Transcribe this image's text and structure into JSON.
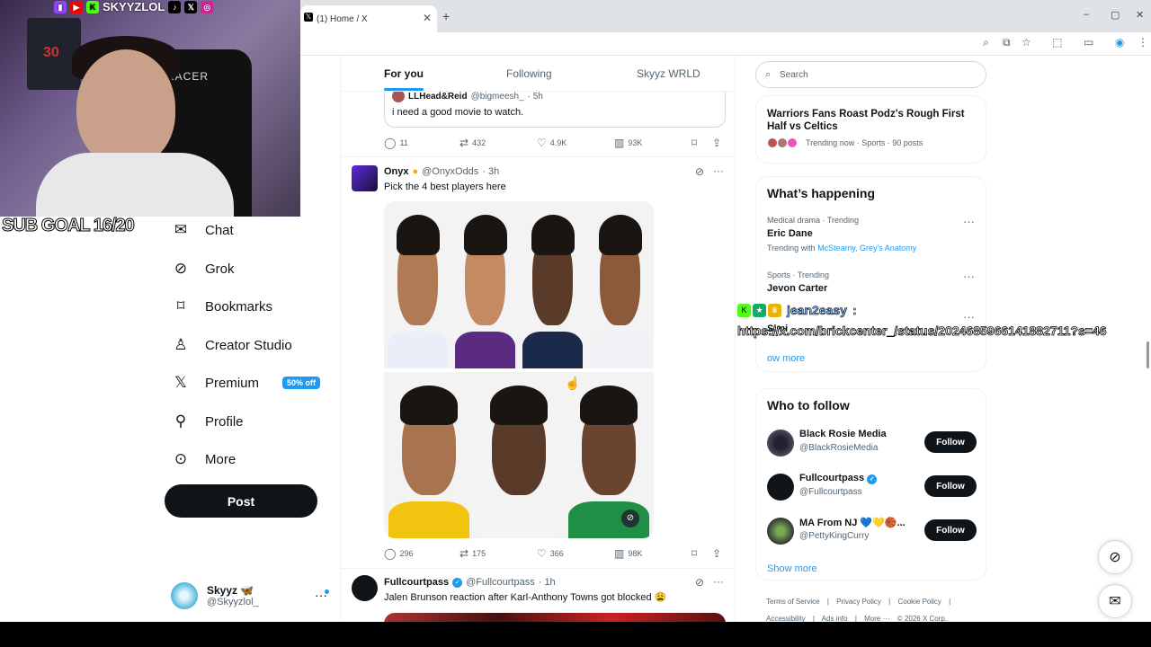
{
  "browser": {
    "tab_title": "(1) Home / X",
    "tab_icon": "x-logo-icon",
    "new_tab": "+",
    "win_min": "–",
    "win_max": "▢",
    "win_close": "✕"
  },
  "overlay": {
    "streamer_name": "SKYYZLOL",
    "sub_goal": "SUB GOAL 16/20",
    "chat_user": "jean2easy",
    "chat_sep": ":",
    "chat_message": "https://x.com/brickcenter_/status/2024685966141882711?s=46"
  },
  "sidebar": {
    "items": [
      {
        "label": "Chat",
        "icon": "envelope-icon",
        "glyph": "✉"
      },
      {
        "label": "Grok",
        "icon": "grok-icon",
        "glyph": "⊘"
      },
      {
        "label": "Bookmarks",
        "icon": "bookmark-icon",
        "glyph": "⌑"
      },
      {
        "label": "Creator Studio",
        "icon": "creator-studio-icon",
        "glyph": "♙"
      },
      {
        "label": "Premium",
        "icon": "x-logo-icon",
        "glyph": "𝕏",
        "badge": "50% off"
      },
      {
        "label": "Profile",
        "icon": "person-icon",
        "glyph": "⚲"
      },
      {
        "label": "More",
        "icon": "more-circle-icon",
        "glyph": "⊙"
      }
    ],
    "post_label": "Post",
    "account_name": "Skyyz 🦋",
    "account_handle": "@Skyyzlol_",
    "account_more": "···"
  },
  "feed": {
    "tabs": [
      "For you",
      "Following",
      "Skyyz WRLD"
    ],
    "quoted": {
      "name": "LLHead&Reid",
      "handle": "@bigmeesh_",
      "time": "· 5h",
      "text": "i need a good movie to watch."
    },
    "stats1": {
      "replies": "11",
      "reposts": "432",
      "likes": "4.9K",
      "views": "93K"
    },
    "tweet2": {
      "name": "Onyx",
      "handle": "@OnyxOdds",
      "time": "· 3h",
      "text": "Pick the 4 best players here"
    },
    "stats2": {
      "replies": "296",
      "reposts": "175",
      "likes": "366",
      "views": "98K"
    },
    "tweet3": {
      "name": "Fullcourtpass",
      "handle": "@Fullcourtpass",
      "time": "· 1h",
      "text": "Jalen Brunson reaction after Karl-Anthony Towns got blocked 😩"
    }
  },
  "right": {
    "search_placeholder": "Search",
    "top_trend": {
      "title": "Warriors Fans Roast Podz's Rough First Half vs Celtics",
      "meta": "Trending now · Sports · 90 posts"
    },
    "whats_happening": "What’s happening",
    "trends": [
      {
        "meta": "Medical drama · Trending",
        "name": "Eric Dane",
        "with_label": "Trending with",
        "with": "McSteamy, Grey's Anatomy"
      },
      {
        "meta": "Sports · Trending",
        "name": "Jevon Carter"
      },
      {
        "name": "Simi"
      }
    ],
    "show_more": "Show more",
    "show_more_partial": "ow more",
    "who_to_follow": "Who to follow",
    "follow": [
      {
        "name": "Black Rosie Media",
        "handle": "@BlackRosieMedia",
        "button": "Follow"
      },
      {
        "name": "Fullcourtpass",
        "handle": "@Fullcourtpass",
        "button": "Follow"
      },
      {
        "name": "MA From NJ 💙💛🏀...",
        "handle": "@PettyKingCurry",
        "button": "Follow"
      }
    ],
    "footer": [
      "Terms of Service",
      "|",
      "Privacy Policy",
      "|",
      "Cookie Policy",
      "|"
    ],
    "footer2": [
      "Accessibility",
      "|",
      "Ads info",
      "|",
      "More ···",
      "© 2026 X Corp."
    ]
  }
}
